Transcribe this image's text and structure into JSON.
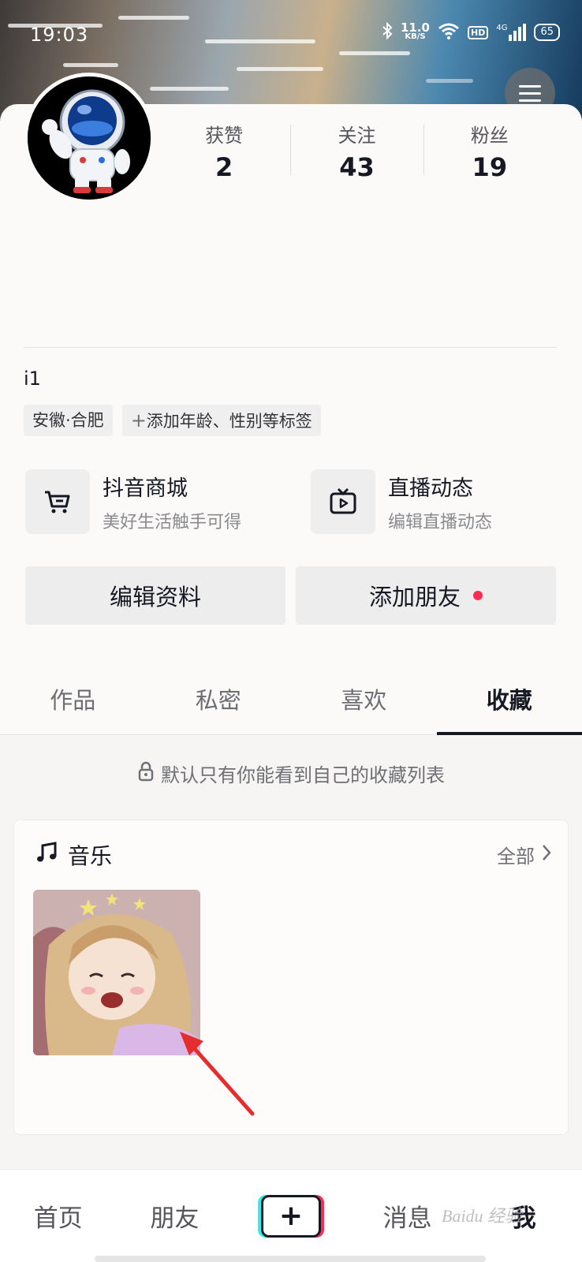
{
  "status_bar": {
    "time": "19:03",
    "net_speed_value": "11.0",
    "net_speed_unit": "KB/S",
    "hd_label": "HD",
    "network_label": "4G",
    "battery_level": "65"
  },
  "profile": {
    "stats": [
      {
        "label": "获赞",
        "value": "2"
      },
      {
        "label": "关注",
        "value": "43"
      },
      {
        "label": "粉丝",
        "value": "19"
      }
    ],
    "username": "i1",
    "tags": [
      "安徽·合肥",
      "添加年龄、性别等标签"
    ]
  },
  "services": [
    {
      "title": "抖音商城",
      "subtitle": "美好生活触手可得",
      "icon": "cart-icon"
    },
    {
      "title": "直播动态",
      "subtitle": "编辑直播动态",
      "icon": "tv-icon"
    }
  ],
  "actions": {
    "edit_profile": "编辑资料",
    "add_friends": "添加朋友"
  },
  "tabs": [
    {
      "label": "作品",
      "active": false
    },
    {
      "label": "私密",
      "active": false
    },
    {
      "label": "喜欢",
      "active": false
    },
    {
      "label": "收藏",
      "active": true
    }
  ],
  "collections": {
    "privacy_note": "默认只有你能看到自己的收藏列表",
    "music_title": "音乐",
    "view_all": "全部"
  },
  "bottom_nav": {
    "home": "首页",
    "friends": "朋友",
    "plus": "+",
    "messages": "消息",
    "me": "我"
  },
  "watermark": "Baidu 经验",
  "colors": {
    "accent_red": "#fe2c55",
    "accent_cyan": "#25f4ee",
    "text_primary": "#161823"
  }
}
